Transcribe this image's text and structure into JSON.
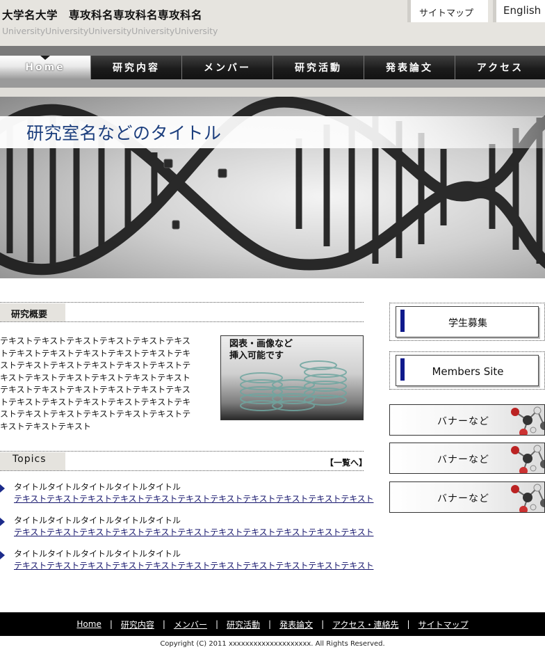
{
  "header": {
    "university_name": "大学名大学　専攻科名専攻科名専攻科名",
    "university_sub": "UniversityUniversityUniversityUniversityUniversity",
    "sitemap_label": "サイトマップ",
    "english_label": "English"
  },
  "nav": {
    "items": [
      {
        "label": "Home"
      },
      {
        "label": "研究内容"
      },
      {
        "label": "メンバー"
      },
      {
        "label": "研究活動"
      },
      {
        "label": "発表論文"
      },
      {
        "label": "アクセス"
      }
    ]
  },
  "hero": {
    "title": "研究室名などのタイトル"
  },
  "overview": {
    "heading": "研究概要",
    "text": "テキストテキストテキストテキストテキストテキストテキストテキストテキストテキストテキストテキストテキストテキストテキストテキストテキストテキストテキストテキストテキストテキストテキストテキストテキストテキストテキストテキストテキストテキストテキストテキストテキストテキストテキストテキストテキストテキストテキストテキストテキストテキストテキスト",
    "figure_caption": "図表・画像など\n挿入可能です"
  },
  "topics": {
    "heading": "Topics",
    "more_label": "【一覧へ】",
    "items": [
      {
        "title": "タイトルタイトルタイトルタイトルタイトル",
        "link": "テキストテキストテキストテキストテキストテキストテキストテキストテキストテキストテキスト"
      },
      {
        "title": "タイトルタイトルタイトルタイトルタイトル",
        "link": "テキストテキストテキストテキストテキストテキストテキストテキストテキストテキストテキスト"
      },
      {
        "title": "タイトルタイトルタイトルタイトルタイトル",
        "link": "テキストテキストテキストテキストテキストテキストテキストテキストテキストテキストテキスト"
      }
    ]
  },
  "sidebar": {
    "banners": [
      {
        "label": "学生募集"
      },
      {
        "label": "Members Site"
      }
    ],
    "ads": [
      {
        "label": "バナーなど"
      },
      {
        "label": "バナーなど"
      },
      {
        "label": "バナーなど"
      }
    ]
  },
  "footer": {
    "links": [
      {
        "label": "Home"
      },
      {
        "label": "研究内容"
      },
      {
        "label": "メンバー"
      },
      {
        "label": "研究活動"
      },
      {
        "label": "発表論文"
      },
      {
        "label": "アクセス・連絡先"
      },
      {
        "label": "サイトマップ"
      }
    ],
    "separator": "|",
    "copyright": "Copyright (C) 2011 xxxxxxxxxxxxxxxxxxxx. All Rights Reserved."
  },
  "colors": {
    "accent_blue": "#1c2b8b",
    "title_blue": "#1d3f7e",
    "footer_bg": "#000000"
  }
}
